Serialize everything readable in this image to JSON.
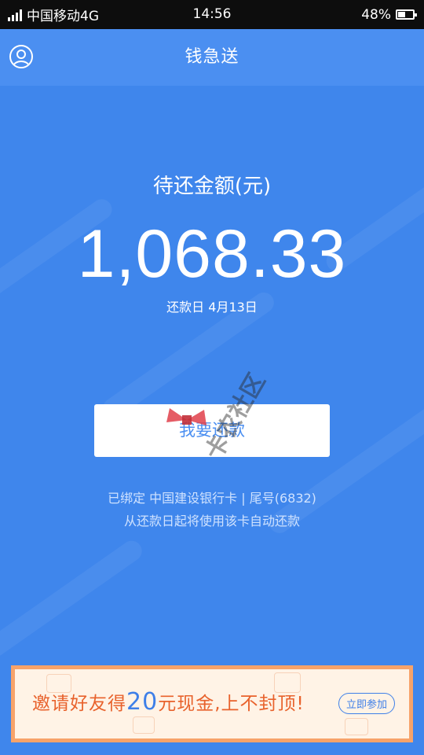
{
  "status_bar": {
    "carrier": "中国移动4G",
    "time": "14:56",
    "battery_text": "48%",
    "battery_level": 0.48
  },
  "header": {
    "title": "钱急送"
  },
  "summary": {
    "amount_label": "待还金额(元)",
    "amount": "1,068.33",
    "due_date": "还款日 4月13日"
  },
  "repay_button": {
    "label": "我要还款"
  },
  "card": {
    "binding": "已绑定  中国建设银行卡 | 尾号(6832)",
    "auto_repay_note": "从还款日起将使用该卡自动还款"
  },
  "banner": {
    "prefix": "邀请好友得",
    "amount": "20",
    "suffix": "元现金,上不封顶!",
    "join_label": "立即参加"
  },
  "watermark": {
    "text": "卡农社区"
  },
  "colors": {
    "primary": "#4b8ff1",
    "accent": "#e8622c"
  }
}
